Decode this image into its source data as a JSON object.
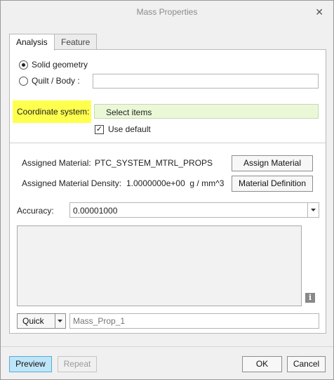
{
  "window": {
    "title": "Mass Properties",
    "close_glyph": "✕"
  },
  "tabs": [
    {
      "label": "Analysis",
      "active": true
    },
    {
      "label": "Feature",
      "active": false
    }
  ],
  "geometry": {
    "solid_label": "Solid geometry",
    "quilt_label": "Quilt / Body :",
    "selected": "solid"
  },
  "coordinate_system": {
    "label": "Coordinate system:",
    "value": "Select items",
    "use_default_label": "Use default",
    "use_default_checked": true,
    "check_glyph": "✓"
  },
  "material": {
    "assigned_label": "Assigned Material:",
    "assigned_value": "PTC_SYSTEM_MTRL_PROPS",
    "assign_button": "Assign Material",
    "density_label": "Assigned Material Density:",
    "density_value": "1.0000000e+00  g / mm^3",
    "definition_button": "Material Definition"
  },
  "accuracy": {
    "label": "Accuracy:",
    "value": "0.00001000"
  },
  "results": {
    "text": "",
    "info_glyph": "i"
  },
  "feature_row": {
    "mode": "Quick",
    "name_placeholder": "Mass_Prop_1"
  },
  "footer": {
    "preview": "Preview",
    "repeat": "Repeat",
    "ok": "OK",
    "cancel": "Cancel"
  },
  "colors": {
    "highlight": "#ffff4d",
    "select_field": "#ebf8d8",
    "preview_button": "#bfe6f8"
  }
}
